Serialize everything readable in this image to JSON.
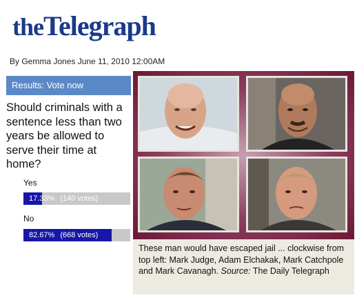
{
  "masthead": {
    "prefix": "the",
    "name": "Telegraph"
  },
  "byline": "By Gemma Jones June 11, 2010 12:00AM",
  "poll": {
    "header": "Results: Vote now",
    "question": "Should criminals with a sentence less than two years be allowed to serve their time at home?",
    "options": [
      {
        "label": "Yes",
        "percent_text": "17.33%",
        "votes_text": "(140 votes)",
        "fraction": 0.1733
      },
      {
        "label": "No",
        "percent_text": "82.67%",
        "votes_text": "(668 votes)",
        "fraction": 0.8267
      }
    ],
    "colors": {
      "header_bg": "#5b89c8",
      "bar_fill": "#1616a8",
      "bar_track": "#c8c8c8"
    }
  },
  "caption": {
    "text": "These man would have escaped jail ... clockwise from top left: Mark Judge, Adam Elchakak, Mark Catchpole and Mark Cavanagh.",
    "source_label": "Source:",
    "source_value": "The Daily Telegraph"
  }
}
